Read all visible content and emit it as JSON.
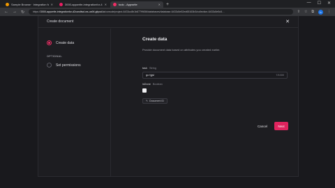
{
  "browser": {
    "tabs": [
      {
        "title": "Sample Browse · Integration fo",
        "favicon_color": "#f29900",
        "active": false
      },
      {
        "title": "3000-appwrite-integrationfor-4…",
        "favicon_color": "#e91e63",
        "active": false
      },
      {
        "title": "todo - Appwrite",
        "favicon_color": "#f02e65",
        "active": true
      }
    ],
    "new_tab": "+",
    "url_prefix": "https://",
    "url_host": "3000-appwrite-integrationfor-d2candlwd.ws-us94.gitpod.io",
    "url_path": "/console/project-6433cc8b1b877f9656/databases/database-6433c5e52ed65163b3/collection-6433c5e5c5…",
    "window_controls": {
      "minimize": "—",
      "maximize": "☐",
      "close": "✕"
    },
    "avatar_letter": "b"
  },
  "modal": {
    "title": "Create document",
    "steps": [
      {
        "label": "Create data",
        "active": true
      },
      {
        "label": "Set permissions",
        "active": false
      }
    ],
    "optional_label": "OPTIONAL",
    "content_title": "Create data",
    "content_subtitle": "Provide document data based on attributes you created earlier.",
    "fields": {
      "task_name": "task",
      "task_type": "String",
      "task_value": "go fgjsl",
      "task_counter": "7/1000",
      "isdone_name": "isDone",
      "isdone_type": "Boolean",
      "isdone_checked": true
    },
    "document_id_button": "Document ID",
    "cancel_label": "Cancel",
    "next_label": "Next"
  }
}
